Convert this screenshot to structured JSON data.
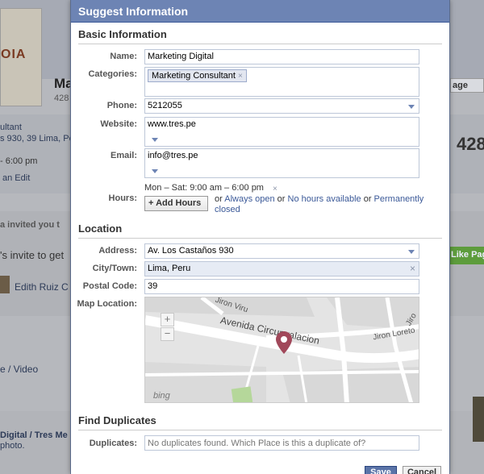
{
  "background": {
    "logo_text": "OIA",
    "name_fragment": "Ma",
    "count_fragment": "428",
    "category_fragment": "ultant",
    "address_fragment": "s 930, 39 Lima, Pe",
    "hours_fragment": "- 6:00 pm",
    "edit_link": "an Edit",
    "invited_text": "a invited you t",
    "invite_text": "'s invite to get",
    "friend_name": "Edith Ruiz C",
    "video_text": "e / Video",
    "page_name_fragment": "Digital / Tres Me",
    "photo_fragment": "photo.",
    "like_page": "Like Pag",
    "manage_fragment": "age",
    "right_count": "428"
  },
  "dialog": {
    "title": "Suggest Information",
    "basic_section": "Basic Information",
    "name_label": "Name:",
    "name_value": "Marketing Digital",
    "categories_label": "Categories:",
    "category_tag": "Marketing Consultant",
    "tag_remove": "×",
    "phone_label": "Phone:",
    "phone_value": "5212055",
    "website_label": "Website:",
    "website_value": "www.tres.pe",
    "email_label": "Email:",
    "email_value": "info@tres.pe",
    "hours_label": "Hours:",
    "hours_value": "Mon – Sat:  9:00 am – 6:00 pm",
    "hours_remove": "×",
    "add_hours": "+ Add Hours",
    "hours_or1": "or",
    "always_open": "Always open",
    "hours_or2": "or",
    "no_hours": "No hours available",
    "hours_or3": "or",
    "permanently_closed": "Permanently closed",
    "location_section": "Location",
    "address_label": "Address:",
    "address_value": "Av. Los Castaños 930",
    "city_label": "City/Town:",
    "city_value": "Lima, Peru",
    "city_remove": "×",
    "postal_label": "Postal Code:",
    "postal_value": "39",
    "map_label": "Map Location:",
    "map_street_1": "Avenida Circunvalacion",
    "map_street_2": "Jiron Loreto",
    "map_street_3": "Jiro",
    "map_street_4": "Jiron Viru",
    "map_brand": "bing",
    "duplicates_section": "Find Duplicates",
    "duplicates_label": "Duplicates:",
    "duplicates_placeholder": "No duplicates found. Which Place is this a duplicate of?",
    "save_button": "Save",
    "cancel_button": "Cancel"
  },
  "colors": {
    "header_blue": "#6d84b4",
    "link_blue": "#3b5998",
    "pin": "#a1485a"
  }
}
